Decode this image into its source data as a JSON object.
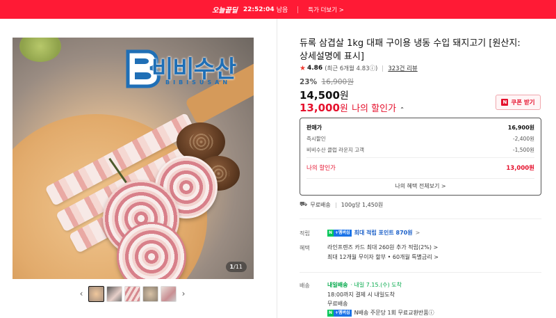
{
  "banner": {
    "deal_label": "오늘끝딜",
    "timer": "22:52:04",
    "remain": "남음",
    "more": "특가 더보기 >"
  },
  "image": {
    "brand_logo_text": "비비수산",
    "brand_logo_sub": "BIBISUSAN",
    "counter_current": "1",
    "counter_total": "/11"
  },
  "thumbnails": {
    "prev": "‹",
    "next": "›",
    "count": 5,
    "active_index": 0
  },
  "product": {
    "title": "듀록 삼겹살 1kg 대패 구이용 냉동 수입 돼지고기 [원산지: 상세설명에 표시]",
    "rating": "4.86",
    "rating_detail": "(최근 6개월 4.83ⓘ)",
    "reviews": "323건 리뷰",
    "discount_pct": "23%",
    "original_price": "16,900원",
    "price": "14,500",
    "price_unit": "원",
    "my_price": "13,000",
    "my_price_unit": "원",
    "my_price_label": "나의 할인가",
    "my_price_caret": "⌃",
    "coupon_label": "쿠폰 받기",
    "coupon_icon": "N"
  },
  "price_box": {
    "head_label": "판매가",
    "head_value": "16,900원",
    "rows": [
      {
        "label": "즉시할인",
        "value": "-2,400원"
      },
      {
        "label": "비비수산 클럽 라운지 고객",
        "value": "-1,500원"
      }
    ],
    "mine_label": "나의 할인가",
    "mine_value": "13,000원",
    "all_link": "나의 혜택 전체보기 >"
  },
  "shipping": {
    "icon": "truck-icon",
    "free": "무료배송",
    "unit_price": "100g당 1,450원"
  },
  "benefits": {
    "points_label": "적립",
    "points_badge_n": "N",
    "points_badge_pay": "+멤버십",
    "points_text": "최대 적립 포인트 870원",
    "points_arrow": ">",
    "card_label": "혜택",
    "card_line1": "라인프렌즈 카드 최대 260원 추가 적립(2%) >",
    "card_line2": "최대 12개월 무이자 할부 • 60개월 특별금리 >"
  },
  "delivery": {
    "label": "배송",
    "badge": "내일배송",
    "arrival": "· 내일 7.15.(수) 도착",
    "line2": "18:00까지 결제 시 내일도착",
    "line3": "무료배송",
    "line4_badge_n": "N",
    "line4_badge_pay": "+멤버십",
    "line4": "N배송 주문당 1회 무료교환반품ⓘ"
  },
  "colors": {
    "accent_red": "#e5102c",
    "banner_red": "#ff1a35",
    "brand_blue": "#1f6fb6",
    "npay_green": "#03c75a"
  }
}
